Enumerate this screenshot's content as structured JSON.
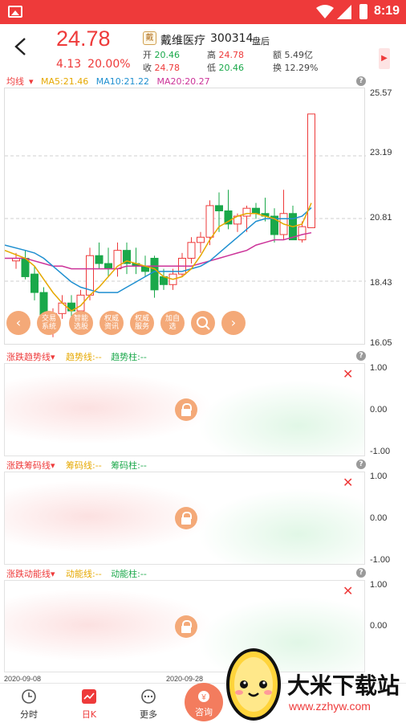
{
  "status_bar": {
    "time": "8:19"
  },
  "header": {
    "price": "24.78",
    "change": "4.13",
    "change_pct": "20.00%",
    "stock_logo": "戴",
    "stock_name": "戴维医疗",
    "stock_code": "300314",
    "market_status": "盘后",
    "open_label": "开",
    "open": "20.46",
    "high_label": "高",
    "high": "24.78",
    "volume_label": "额",
    "volume": "5.49亿",
    "close_label": "收",
    "close": "24.78",
    "low_label": "低",
    "low": "20.46",
    "turnover_label": "换",
    "turnover": "12.29%"
  },
  "ma": {
    "dropdown": "均线",
    "ma5": "MA5:21.46",
    "ma10": "MA10:21.22",
    "ma20": "MA20:20.27"
  },
  "colors": {
    "up": "#ee3a3a",
    "down": "#1aa84a",
    "ma5": "#e6a800",
    "ma10": "#1e8fd0",
    "ma20": "#cc3399"
  },
  "chart_data": {
    "type": "candlestick",
    "y_ticks": [
      "25.57",
      "23.19",
      "20.81",
      "18.43",
      "16.05"
    ],
    "ylim": [
      16.05,
      25.57
    ],
    "x_labels": [
      "2020-09-08",
      "2020-09-28"
    ],
    "candles": [
      {
        "o": 19.2,
        "h": 19.5,
        "l": 18.9,
        "c": 19.3
      },
      {
        "o": 19.3,
        "h": 19.6,
        "l": 18.5,
        "c": 18.6
      },
      {
        "o": 18.7,
        "h": 19.0,
        "l": 17.7,
        "c": 18.0
      },
      {
        "o": 18.0,
        "h": 18.2,
        "l": 16.5,
        "c": 16.8
      },
      {
        "o": 16.9,
        "h": 17.4,
        "l": 16.3,
        "c": 17.2
      },
      {
        "o": 17.2,
        "h": 17.9,
        "l": 17.0,
        "c": 17.6
      },
      {
        "o": 17.6,
        "h": 17.9,
        "l": 17.0,
        "c": 17.3
      },
      {
        "o": 17.3,
        "h": 18.1,
        "l": 17.1,
        "c": 17.9
      },
      {
        "o": 17.9,
        "h": 19.7,
        "l": 17.7,
        "c": 19.4
      },
      {
        "o": 19.4,
        "h": 19.9,
        "l": 18.9,
        "c": 19.1
      },
      {
        "o": 19.1,
        "h": 19.7,
        "l": 18.6,
        "c": 18.9
      },
      {
        "o": 18.9,
        "h": 19.9,
        "l": 18.6,
        "c": 19.6
      },
      {
        "o": 19.6,
        "h": 19.9,
        "l": 18.7,
        "c": 19.1
      },
      {
        "o": 19.1,
        "h": 19.7,
        "l": 18.7,
        "c": 19.0
      },
      {
        "o": 19.0,
        "h": 19.4,
        "l": 18.6,
        "c": 18.8
      },
      {
        "o": 19.3,
        "h": 19.4,
        "l": 17.8,
        "c": 18.1
      },
      {
        "o": 18.6,
        "h": 18.9,
        "l": 18.1,
        "c": 18.3
      },
      {
        "o": 18.3,
        "h": 18.9,
        "l": 18.1,
        "c": 18.7
      },
      {
        "o": 18.7,
        "h": 19.5,
        "l": 18.6,
        "c": 19.3
      },
      {
        "o": 19.3,
        "h": 20.1,
        "l": 19.1,
        "c": 19.9
      },
      {
        "o": 19.9,
        "h": 20.3,
        "l": 19.5,
        "c": 20.1
      },
      {
        "o": 20.1,
        "h": 21.5,
        "l": 19.8,
        "c": 21.3
      },
      {
        "o": 21.3,
        "h": 21.8,
        "l": 20.3,
        "c": 21.1
      },
      {
        "o": 21.1,
        "h": 21.9,
        "l": 20.4,
        "c": 20.6
      },
      {
        "o": 20.6,
        "h": 21.0,
        "l": 20.3,
        "c": 20.9
      },
      {
        "o": 20.9,
        "h": 21.3,
        "l": 20.3,
        "c": 21.2
      },
      {
        "o": 21.2,
        "h": 21.4,
        "l": 20.8,
        "c": 21.0
      },
      {
        "o": 21.0,
        "h": 21.6,
        "l": 20.7,
        "c": 20.9
      },
      {
        "o": 20.9,
        "h": 21.2,
        "l": 19.9,
        "c": 20.2
      },
      {
        "o": 20.2,
        "h": 21.9,
        "l": 20.0,
        "c": 21.0
      },
      {
        "o": 21.0,
        "h": 21.3,
        "l": 20.0,
        "c": 20.0
      },
      {
        "o": 20.0,
        "h": 20.7,
        "l": 19.9,
        "c": 20.5
      },
      {
        "o": 20.46,
        "h": 24.78,
        "l": 20.46,
        "c": 24.78
      }
    ],
    "ma5": [
      19.6,
      19.3,
      19.0,
      18.5,
      18.0,
      17.6,
      17.3,
      17.5,
      17.9,
      18.2,
      18.6,
      19.0,
      19.2,
      19.1,
      19.0,
      18.9,
      18.6,
      18.5,
      18.6,
      18.9,
      19.4,
      20.0,
      20.5,
      20.7,
      20.9,
      21.0,
      21.0,
      20.9,
      20.8,
      20.6,
      20.5,
      20.6,
      21.4
    ],
    "ma10": [
      19.8,
      19.6,
      19.5,
      19.3,
      19.0,
      18.7,
      18.4,
      18.2,
      18.1,
      18.0,
      18.0,
      18.0,
      18.2,
      18.4,
      18.6,
      18.8,
      18.8,
      18.8,
      18.8,
      18.9,
      19.0,
      19.2,
      19.5,
      19.8,
      20.1,
      20.4,
      20.7,
      20.8,
      20.8,
      20.8,
      20.8,
      20.9,
      21.22
    ],
    "ma20": [
      19.3,
      19.3,
      19.2,
      19.1,
      19.0,
      19.0,
      18.9,
      18.9,
      18.9,
      18.9,
      18.9,
      18.9,
      19.0,
      19.0,
      19.0,
      19.0,
      19.0,
      19.0,
      19.0,
      19.0,
      19.1,
      19.2,
      19.3,
      19.4,
      19.5,
      19.6,
      19.8,
      19.9,
      20.0,
      20.0,
      20.1,
      20.2,
      20.27
    ]
  },
  "quick_actions": [
    "交易系统",
    "智能选股",
    "权威资讯",
    "权威服务",
    "加自选"
  ],
  "indicators": [
    {
      "title": "涨跌趋势线",
      "line1": "趋势线:--",
      "line2": "趋势柱:--",
      "y_top": "1.00",
      "y_mid": "0.00",
      "y_bot": "-1.00"
    },
    {
      "title": "涨跌筹码线",
      "line1": "筹码线:--",
      "line2": "筹码柱:--",
      "y_top": "1.00",
      "y_mid": "0.00",
      "y_bot": "-1.00"
    },
    {
      "title": "涨跌动能线",
      "line1": "动能线:--",
      "line2": "动能柱:--",
      "y_top": "1.00",
      "y_mid": "0.00"
    }
  ],
  "bottom_nav": {
    "tab1": "分时",
    "tab2": "日K",
    "tab3": "更多",
    "consult": "咨询"
  },
  "watermark": {
    "text": "大米下载站",
    "url": "www.zzhyw.com"
  }
}
